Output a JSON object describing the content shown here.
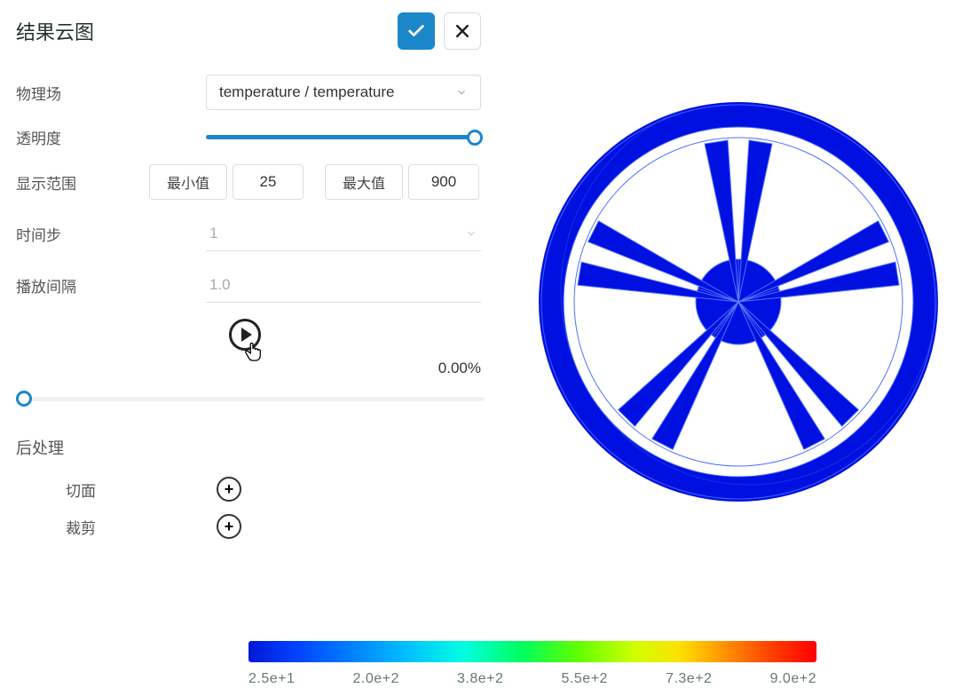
{
  "panel": {
    "title": "结果云图",
    "physics_label": "物理场",
    "physics_value": "temperature / temperature",
    "opacity_label": "透明度",
    "opacity_value": 100,
    "range_label": "显示范围",
    "range_min_label": "最小值",
    "range_min_value": "25",
    "range_max_label": "最大值",
    "range_max_value": "900",
    "timestep_label": "时间步",
    "timestep_value": "1",
    "interval_label": "播放间隔",
    "interval_value": "1.0",
    "progress_text": "0.00%",
    "progress_value": 0,
    "postproc_title": "后处理",
    "section_plane_label": "切面",
    "clip_label": "裁剪"
  },
  "legend": {
    "ticks": [
      "2.5e+1",
      "2.0e+2",
      "3.8e+2",
      "5.5e+2",
      "7.3e+2",
      "9.0e+2"
    ]
  },
  "colors": {
    "accent": "#1b87c9",
    "wheel_fill": "#0010e0"
  }
}
